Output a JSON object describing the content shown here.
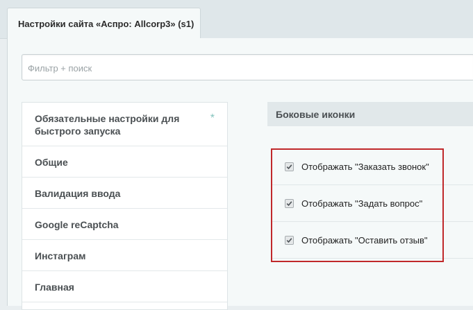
{
  "tab": {
    "title": "Настройки сайта «Аспро: Allcorp3» (s1)"
  },
  "search": {
    "placeholder": "Фильтр + поиск"
  },
  "sidebar": {
    "items": [
      {
        "label": "Обязательные настройки для быстрого запуска",
        "starred": true,
        "star": "*"
      },
      {
        "label": "Общие"
      },
      {
        "label": "Валидация ввода"
      },
      {
        "label": "Google reCaptcha"
      },
      {
        "label": "Инстаграм"
      },
      {
        "label": "Главная"
      }
    ]
  },
  "section": {
    "title": "Боковые иконки",
    "options": [
      {
        "label": "Отображать \"Заказать звонок\"",
        "checked": true
      },
      {
        "label": "Отображать \"Задать вопрос\"",
        "checked": true
      },
      {
        "label": "Отображать \"Оставить отзыв\"",
        "checked": true
      }
    ]
  },
  "colors": {
    "highlight_border": "#c0282a",
    "star": "#86c4be"
  },
  "icons": {
    "star": "asterisk-icon",
    "checkbox": "checkmark-icon"
  }
}
